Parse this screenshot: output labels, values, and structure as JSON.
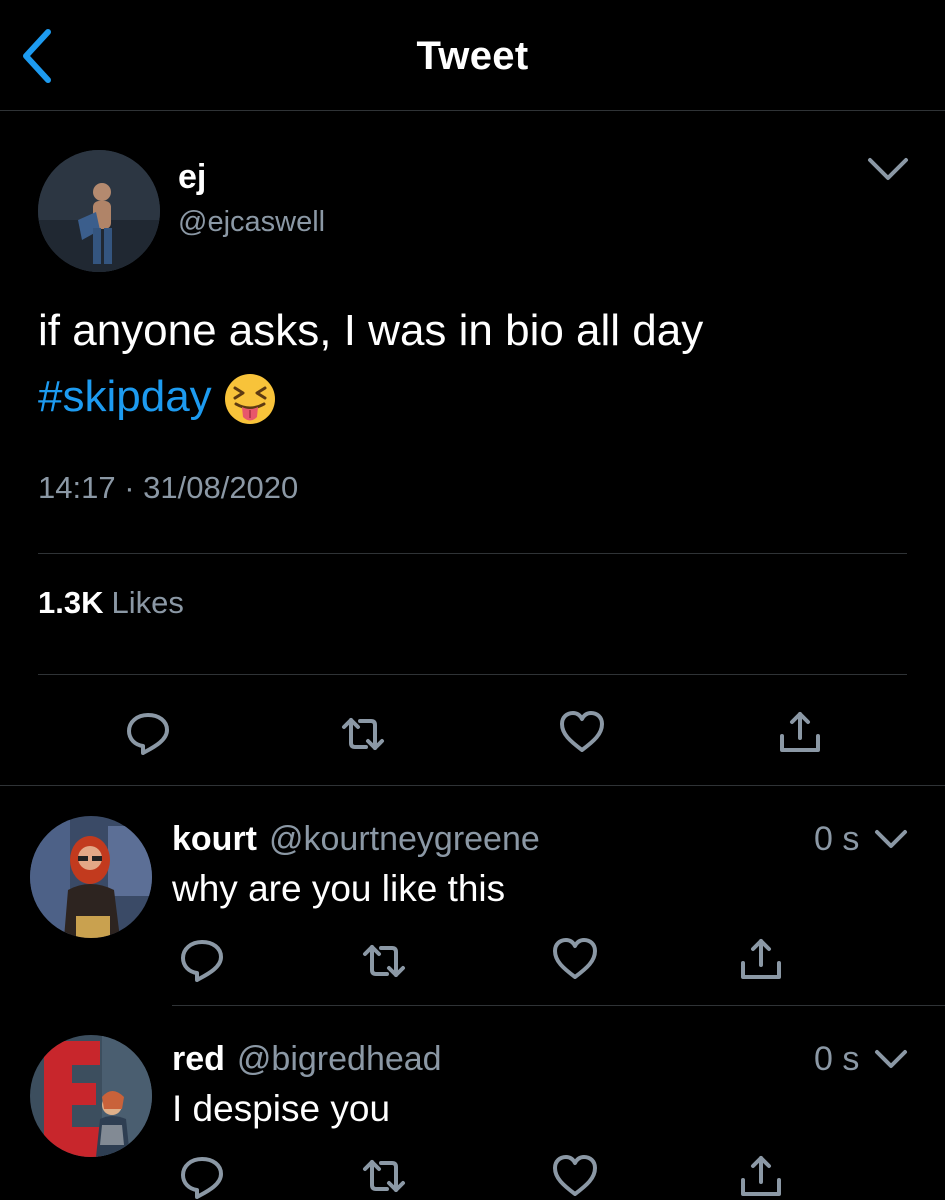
{
  "header": {
    "title": "Tweet"
  },
  "main_tweet": {
    "author_name": "ej",
    "author_handle": "@ejcaswell",
    "text_line1": "if anyone asks, I was in bio all day",
    "hashtag": "#skipday",
    "emoji": "😝",
    "timestamp": "14:17 · 31/08/2020",
    "likes_count": "1.3K",
    "likes_label": "Likes"
  },
  "replies": [
    {
      "name": "kourt",
      "handle": "@kourtneygreene",
      "text": "why are you like this",
      "time": "0 s"
    },
    {
      "name": "red",
      "handle": "@bigredhead",
      "text": "I despise you",
      "time": "0 s"
    }
  ],
  "colors": {
    "background": "#000000",
    "link": "#1d9bf0",
    "secondary_text": "#8b98a5",
    "divider": "#2f3336",
    "back_arrow": "#1d9bf0"
  },
  "icons": {
    "back": "chevron-left-icon",
    "more": "chevron-down-icon",
    "reply": "reply-icon",
    "retweet": "retweet-icon",
    "like": "heart-icon",
    "share": "share-icon"
  }
}
